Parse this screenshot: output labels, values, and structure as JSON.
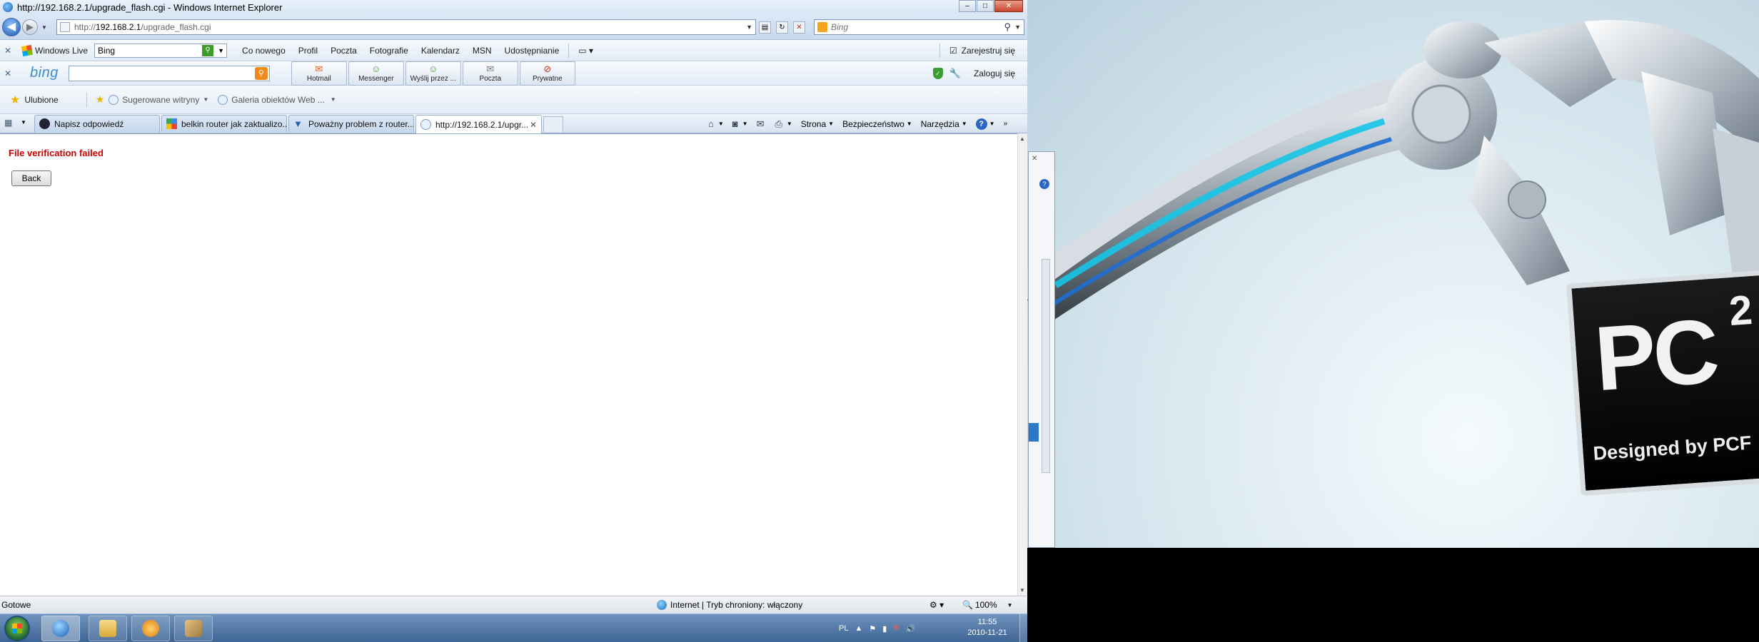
{
  "window": {
    "title": "http://192.168.2.1/upgrade_flash.cgi - Windows Internet Explorer",
    "controls": [
      "–",
      "□",
      "✕"
    ]
  },
  "address": {
    "url_prefix": "http://",
    "url_host": "192.168.2.1",
    "url_path": "/upgrade_flash.cgi",
    "search_placeholder": "Bing"
  },
  "windows_live": {
    "label": "Windows Live",
    "search_value": "Bing",
    "links": [
      "Co nowego",
      "Profil",
      "Poczta",
      "Fotografie",
      "Kalendarz",
      "MSN",
      "Udostępnianie"
    ],
    "signup": "Zarejestruj się"
  },
  "bing_bar": {
    "logo": "bing",
    "buttons": [
      {
        "label": "Hotmail",
        "icon": "hotmail-icon"
      },
      {
        "label": "Messenger",
        "icon": "messenger-icon"
      },
      {
        "label": "Wyślij przez ...",
        "icon": "send-icon"
      },
      {
        "label": "Poczta",
        "icon": "mail-icon"
      },
      {
        "label": "Prywatne",
        "icon": "private-icon"
      }
    ],
    "login": "Zaloguj się"
  },
  "favorites": {
    "label": "Ulubione",
    "items": [
      "Sugerowane witryny",
      "Galeria obiektów Web ..."
    ]
  },
  "tabs": [
    {
      "label": "Napisz odpowiedź",
      "active": false
    },
    {
      "label": "belkin router jak zaktualizo...",
      "active": false
    },
    {
      "label": "Poważny problem z router...",
      "active": false
    },
    {
      "label": "http://192.168.2.1/upgr...",
      "active": true
    }
  ],
  "commands": [
    "Strona",
    "Bezpieczeństwo",
    "Narzędzia"
  ],
  "page": {
    "error": "File verification failed",
    "back_button": "Back"
  },
  "status": {
    "text": "Gotowe",
    "zone": "Internet | Tryb chroniony: włączony",
    "zoom": "100%"
  },
  "taskbar": {
    "language": "PL",
    "time": "11:55",
    "date": "2010-11-21"
  },
  "wallpaper": {
    "logo": "PC",
    "superscript": "2",
    "tagline": "Designed by PCF"
  },
  "colors": {
    "error_red": "#cc0000",
    "taskbar_blue": "#4f74a3",
    "bing_blue": "#3a8bd6"
  }
}
